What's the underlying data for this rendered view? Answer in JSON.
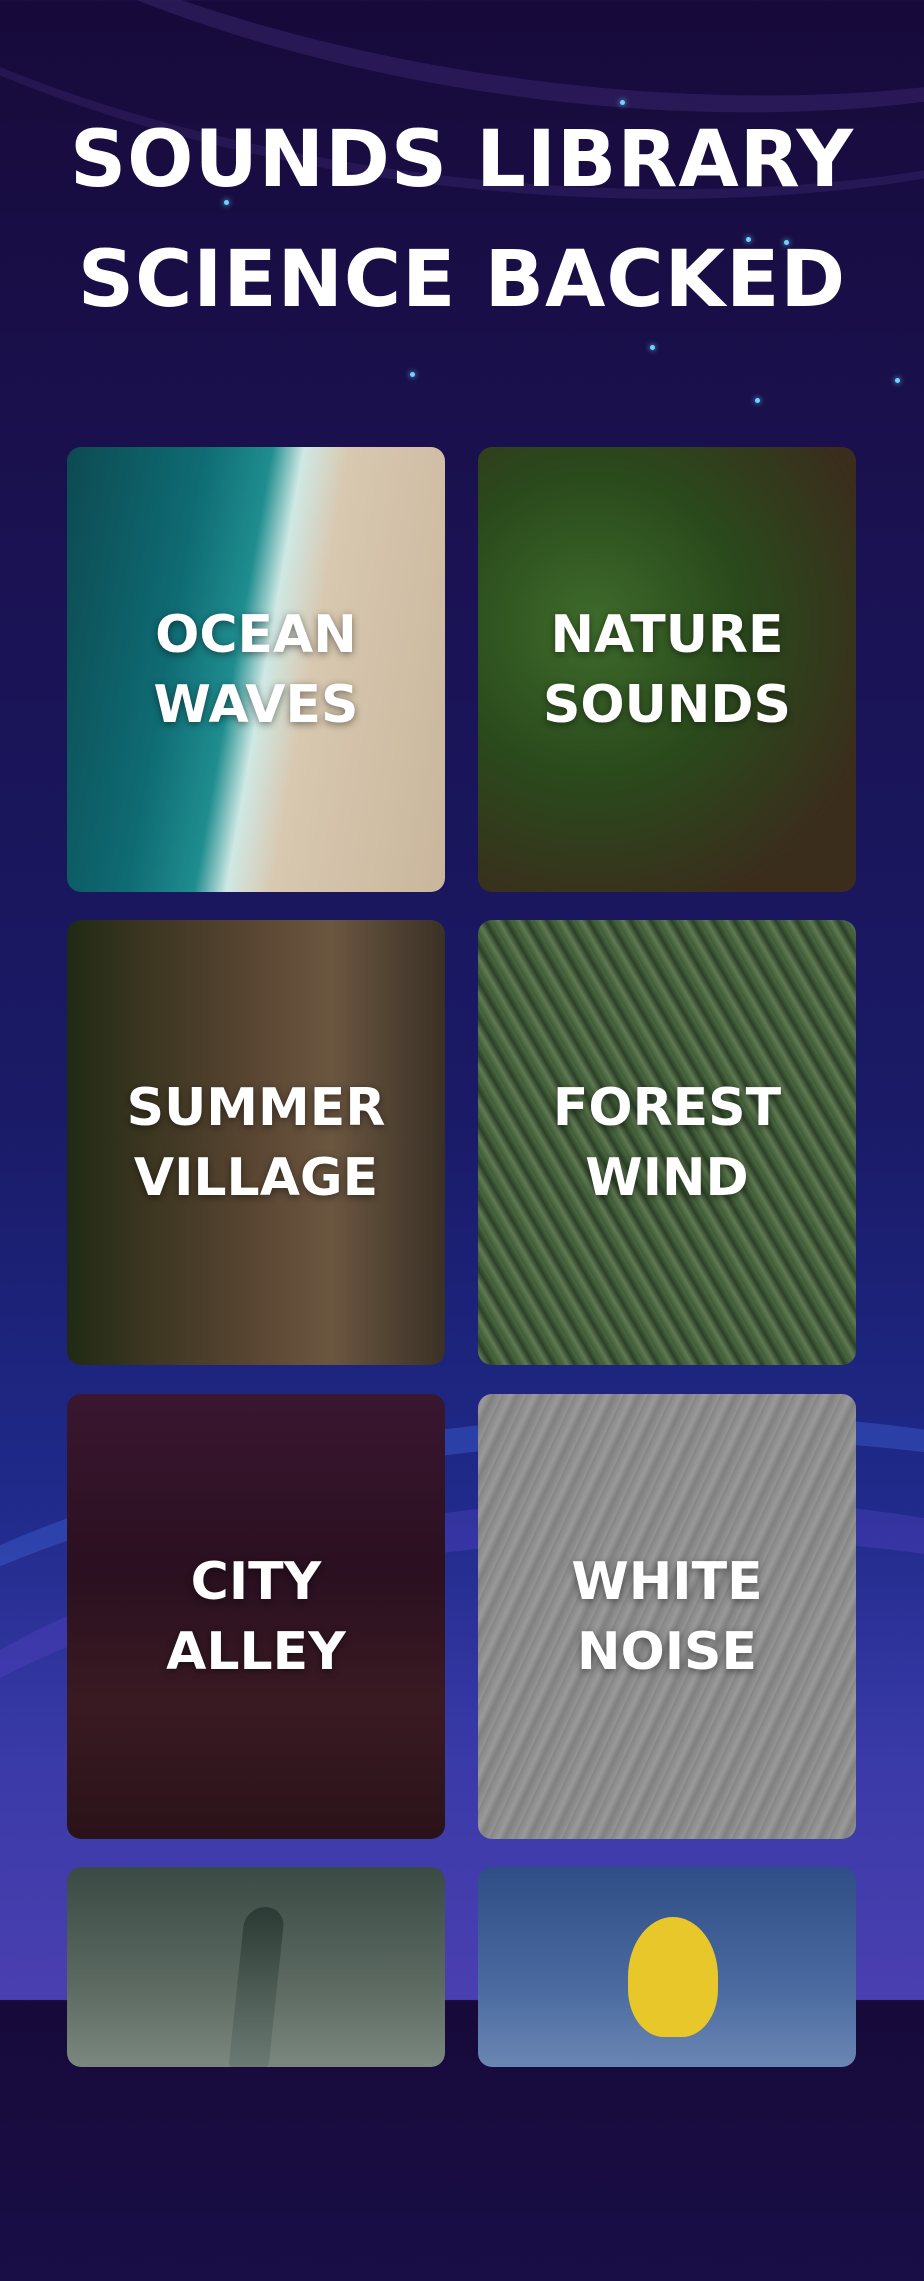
{
  "header": {
    "line1": "SOUNDS LIBRARY",
    "line2": "SCIENCE BACKED"
  },
  "cards": [
    {
      "line1": "OCEAN",
      "line2": "WAVES"
    },
    {
      "line1": "NATURE",
      "line2": "SOUNDS"
    },
    {
      "line1": "SUMMER",
      "line2": "VILLAGE"
    },
    {
      "line1": "FOREST",
      "line2": "WIND"
    },
    {
      "line1": "CITY",
      "line2": "ALLEY"
    },
    {
      "line1": "WHITE",
      "line2": "NOISE"
    },
    {
      "line1": "",
      "line2": ""
    },
    {
      "line1": "",
      "line2": ""
    }
  ]
}
